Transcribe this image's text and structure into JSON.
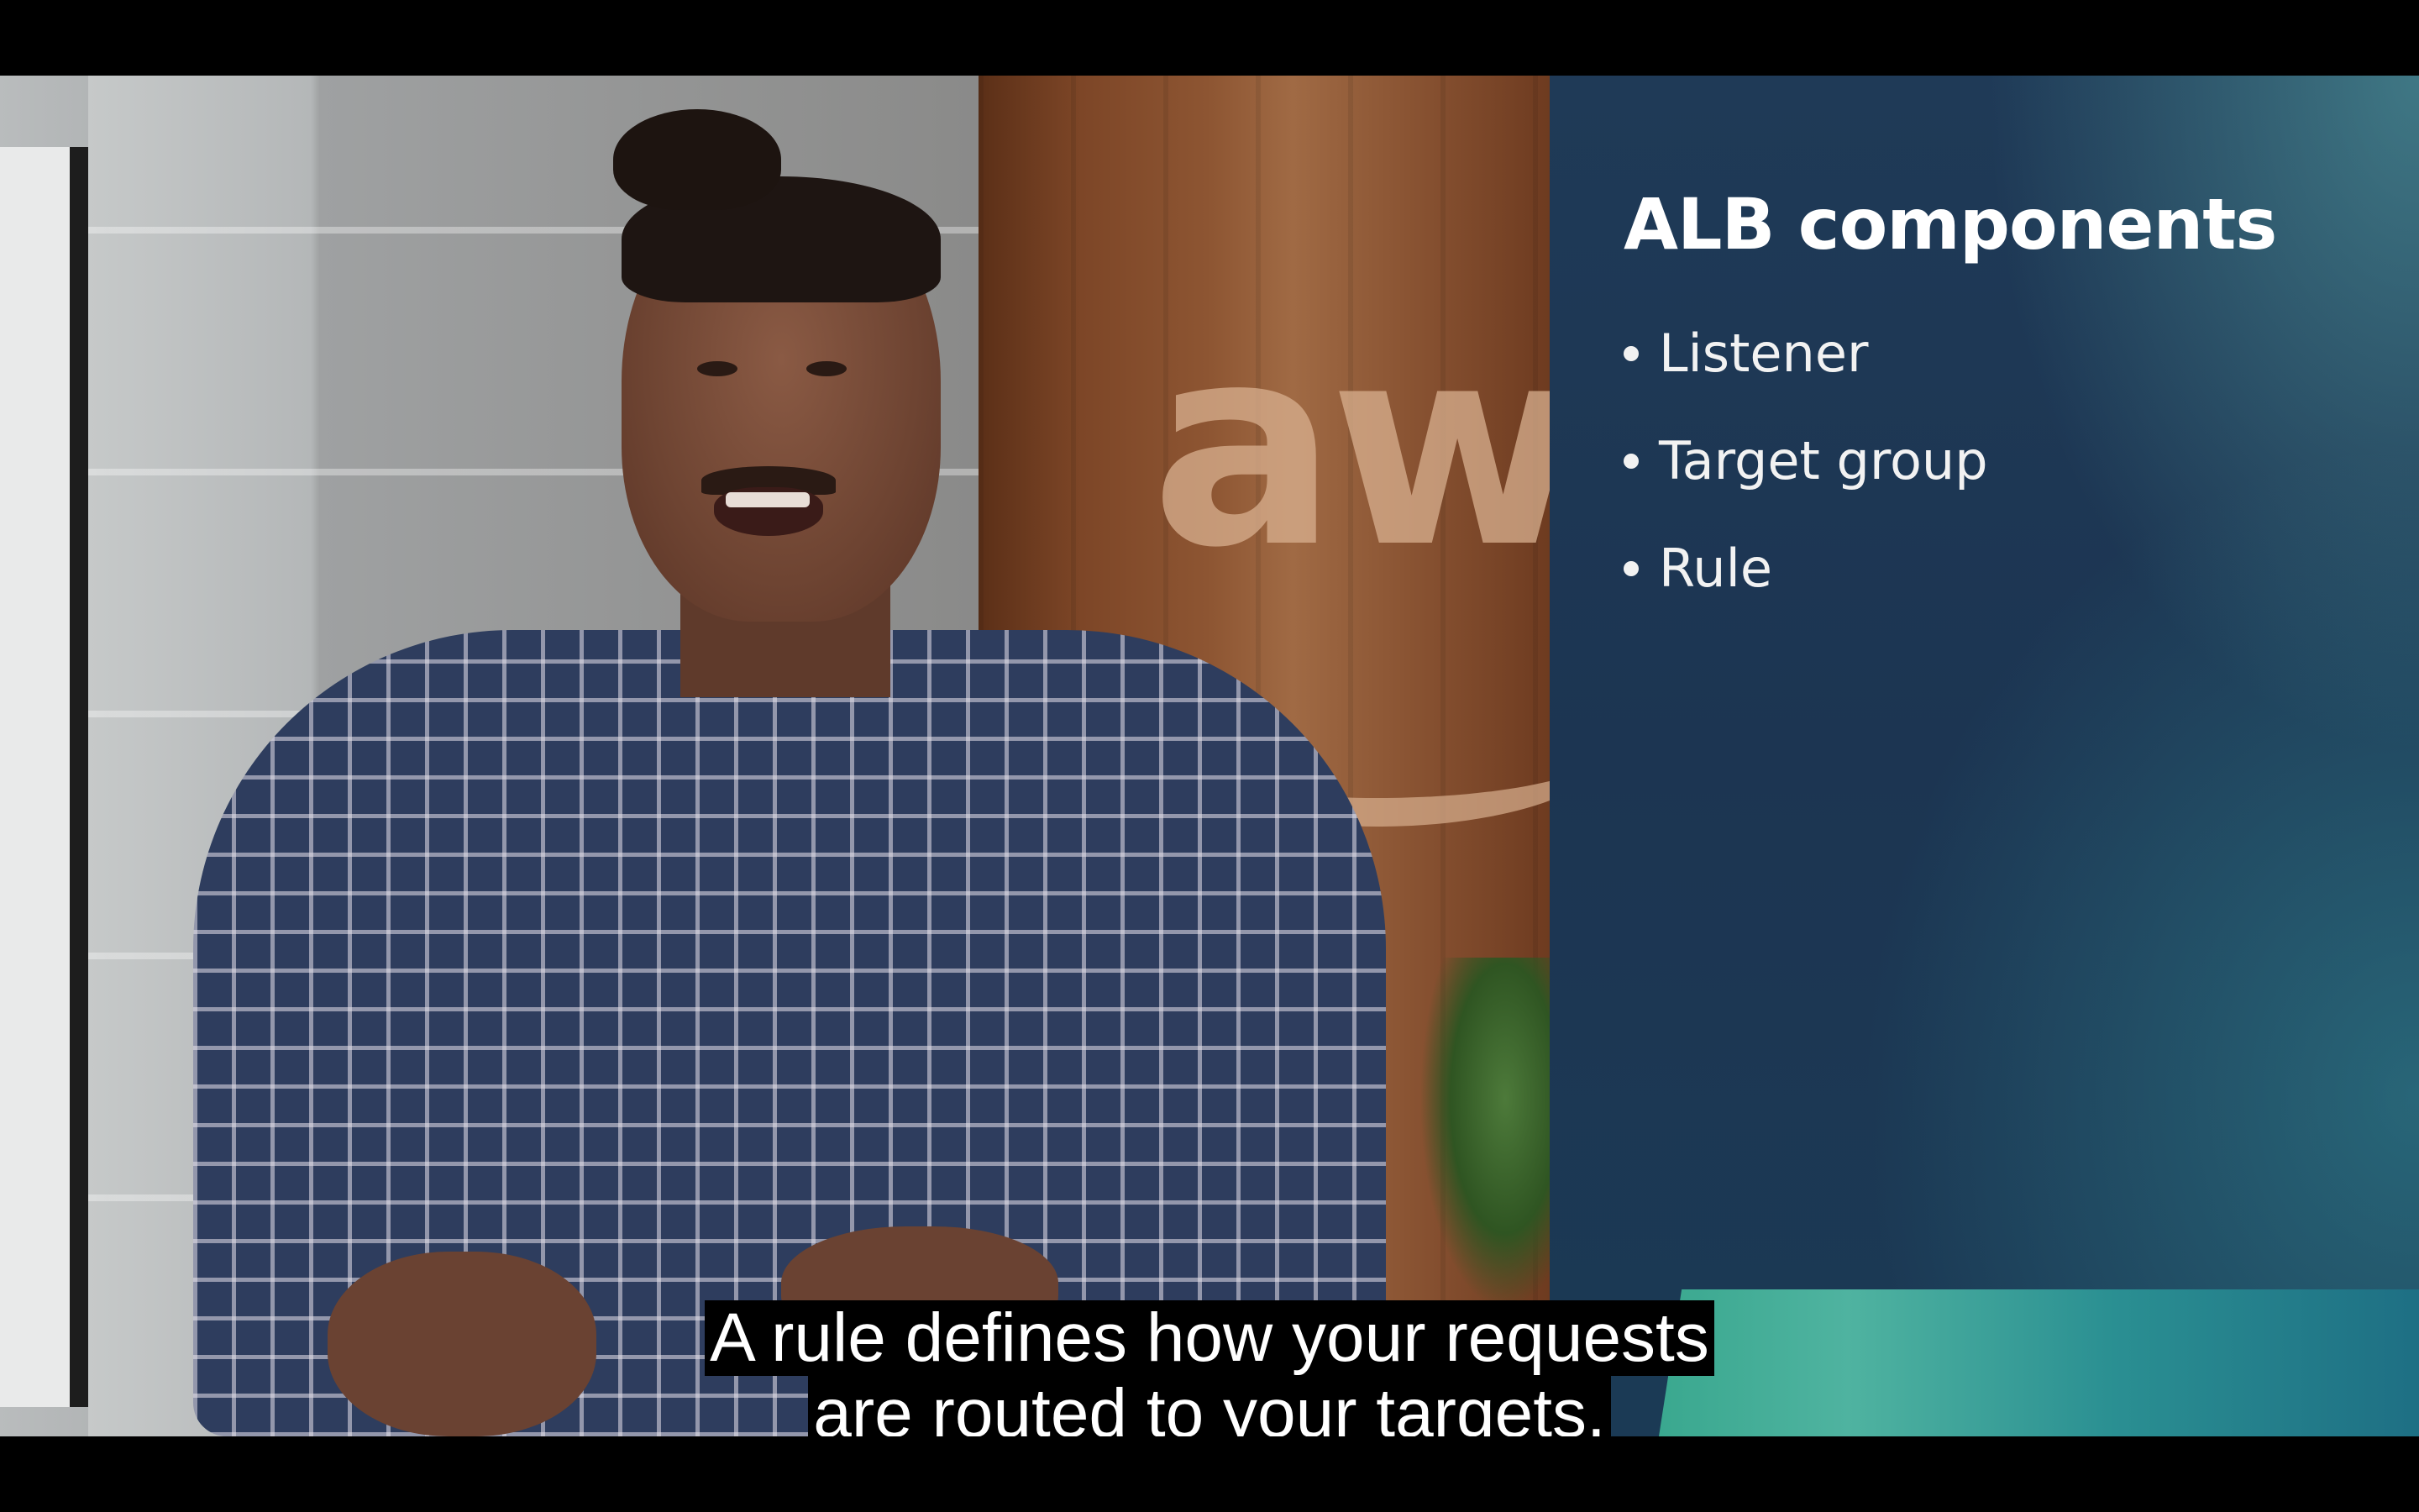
{
  "slide": {
    "title": "ALB components",
    "bullets": [
      "Listener",
      "Target group",
      "Rule"
    ]
  },
  "background_logo": "aw",
  "captions": {
    "line1": "A rule defines how your requests",
    "line2": "are routed to your targets."
  },
  "colors": {
    "slide_bg": "#1c3552",
    "accent_teal": "#3aa88f",
    "caption_bg": "#000000",
    "caption_text": "#ffffff"
  }
}
